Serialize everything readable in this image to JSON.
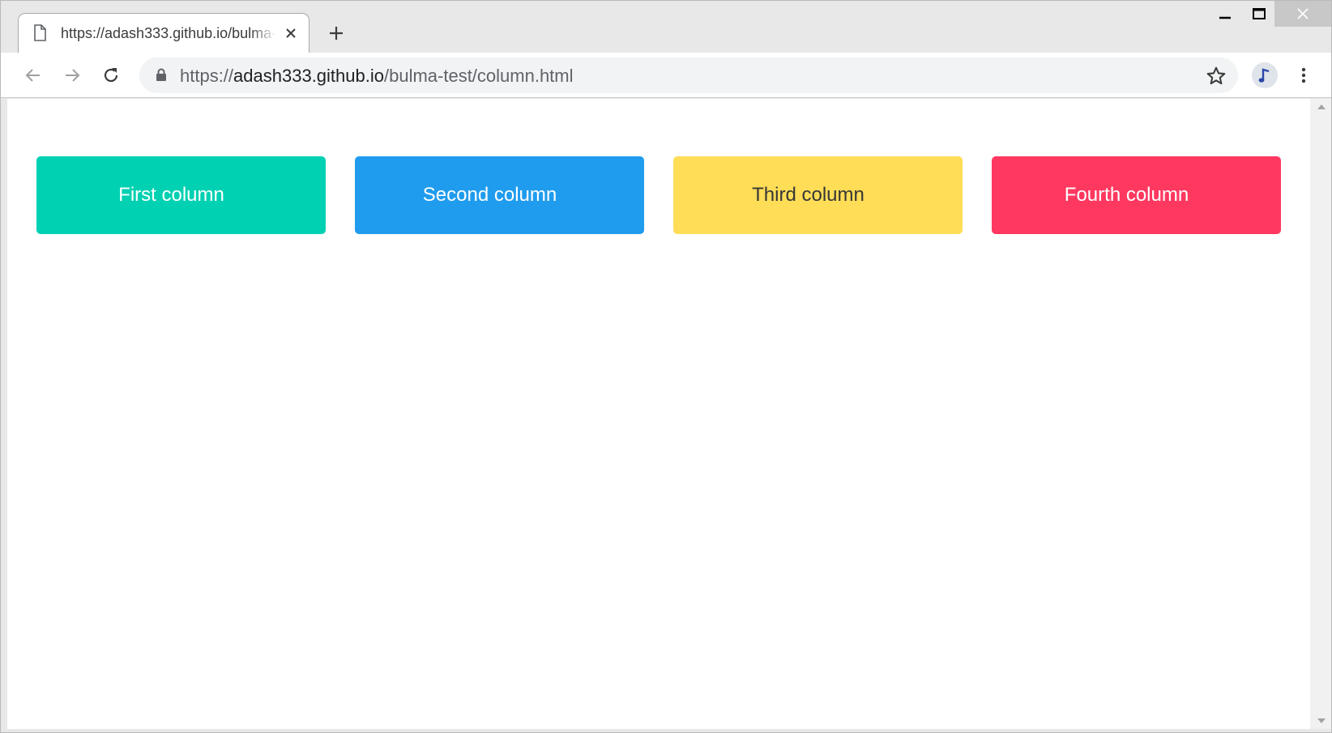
{
  "browser": {
    "tab": {
      "title": "https://adash333.github.io/bulma-test/column.html",
      "icon": "document-icon"
    },
    "address": {
      "scheme": "https://",
      "host": "adash333.github.io",
      "path": "/bulma-test/column.html"
    },
    "icons": [
      "back-arrow-icon",
      "forward-arrow-icon",
      "reload-icon",
      "lock-icon",
      "star-icon",
      "avatar-icon",
      "kebab-menu-icon",
      "close-icon",
      "plus-icon"
    ]
  },
  "columns": [
    {
      "label": "First column",
      "color": "#00d1b2",
      "text_color": "#ffffff"
    },
    {
      "label": "Second column",
      "color": "#209cee",
      "text_color": "#ffffff"
    },
    {
      "label": "Third column",
      "color": "#ffdd57",
      "text_color": "#363636"
    },
    {
      "label": "Fourth column",
      "color": "#ff3860",
      "text_color": "#ffffff"
    }
  ]
}
